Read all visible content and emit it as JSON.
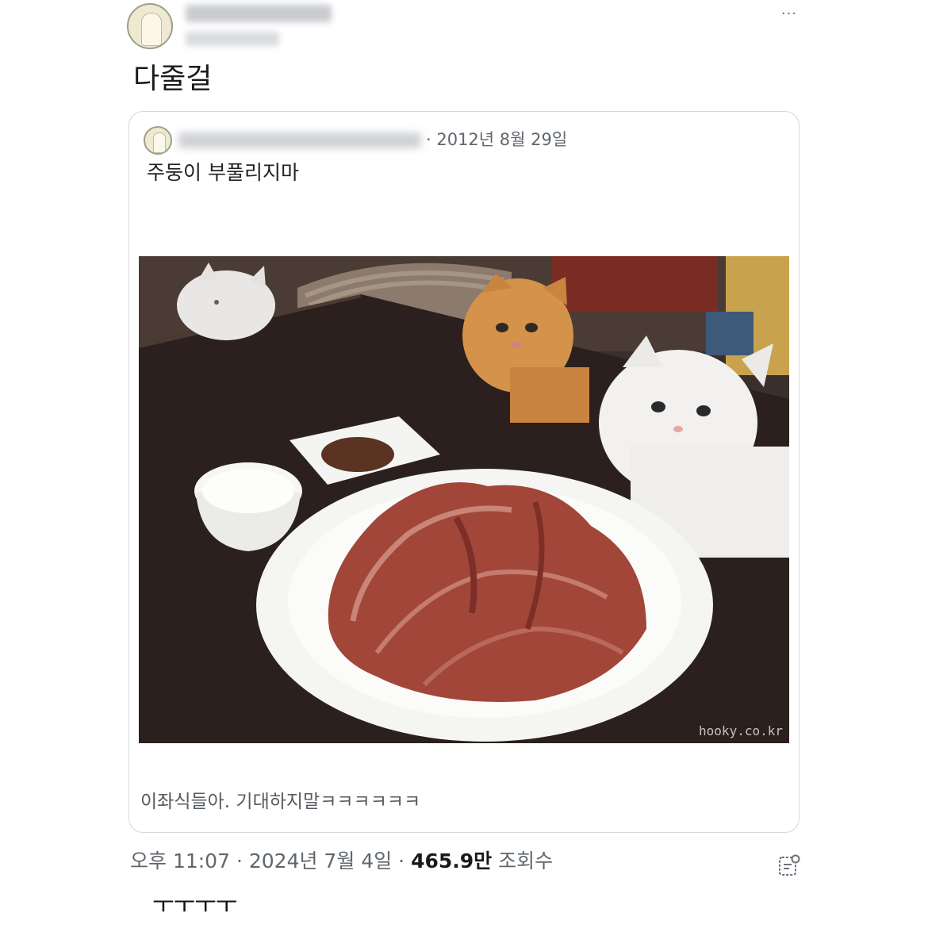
{
  "header": {
    "more_icon": "more-horizontal-icon",
    "more_label": "···"
  },
  "post": {
    "text": "다줄걸"
  },
  "quote": {
    "date": "· 2012년 8월 29일",
    "text": "주둥이 부풀리지마",
    "watermark": "hooky.co.kr",
    "caption": "이좌식들아. 기대하지말ㅋㅋㅋㅋㅋㅋ"
  },
  "meta": {
    "time": "오후 11:07",
    "date": "2024년 7월 4일",
    "views": "465.9만",
    "views_label": "조회수",
    "stats_icon": "analytics-icon"
  },
  "reply": {
    "text": "ㅜㅜㅜㅜ"
  },
  "colors": {
    "text": "#111111",
    "muted": "#5f666d",
    "border": "#d5d8dc"
  }
}
